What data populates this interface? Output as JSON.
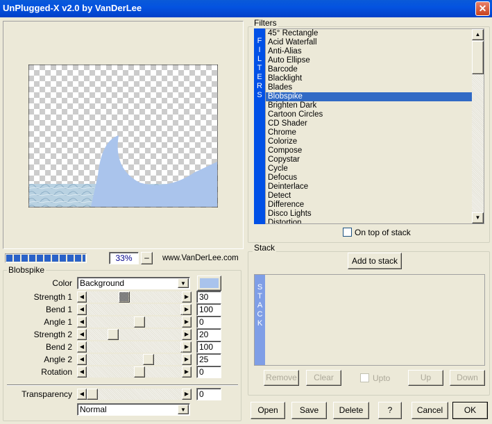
{
  "window": {
    "title": "UnPlugged-X v2.0 by VanDerLee",
    "close_icon": "close-icon"
  },
  "preview": {
    "zoom": "33%",
    "zoom_minus": "–",
    "website": "www.VanDerLee.com",
    "progress_fraction": 1.0,
    "shape_color": "#aac4ec",
    "watermark_title": "Pinuccia",
    "watermark_url": "www.maidiregrafica.eu"
  },
  "params": {
    "group_title": "Blobspike",
    "color_label": "Color",
    "color_value": "Background",
    "swatch_color": "#a9c3ec",
    "sliders": [
      {
        "label": "Strength 1",
        "value": "30",
        "position": 0.34,
        "focused": true
      },
      {
        "label": "Bend 1",
        "value": "100",
        "position": 1.0
      },
      {
        "label": "Angle 1",
        "value": "0",
        "position": 0.5
      },
      {
        "label": "Strength 2",
        "value": "20",
        "position": 0.22
      },
      {
        "label": "Bend 2",
        "value": "100",
        "position": 1.0
      },
      {
        "label": "Angle 2",
        "value": "25",
        "position": 0.6
      },
      {
        "label": "Rotation",
        "value": "0",
        "position": 0.5
      }
    ],
    "transparency": {
      "label": "Transparency",
      "value": "0",
      "position": 0.0
    },
    "blend_mode": "Normal"
  },
  "filters": {
    "group_title": "Filters",
    "strip_label": "FILTERS",
    "items": [
      "45° Rectangle",
      "Acid Waterfall",
      "Anti-Alias",
      "Auto Ellipse",
      "Barcode",
      "Blacklight",
      "Blades",
      "Blobspike",
      "Brighten Dark",
      "Cartoon Circles",
      "CD Shader",
      "Chrome",
      "Colorize",
      "Compose",
      "Copystar",
      "Cycle",
      "Defocus",
      "Deinterlace",
      "Detect",
      "Difference",
      "Disco Lights",
      "Distortion"
    ],
    "selected": "Blobspike",
    "on_top_label": "On top of stack"
  },
  "stack": {
    "group_title": "Stack",
    "strip_label": "STACK",
    "add_label": "Add to stack",
    "remove": "Remove",
    "clear": "Clear",
    "upto": "Upto",
    "up": "Up",
    "down": "Down"
  },
  "footer": {
    "open": "Open",
    "save": "Save",
    "delete": "Delete",
    "help": "?",
    "cancel": "Cancel",
    "ok": "OK"
  }
}
